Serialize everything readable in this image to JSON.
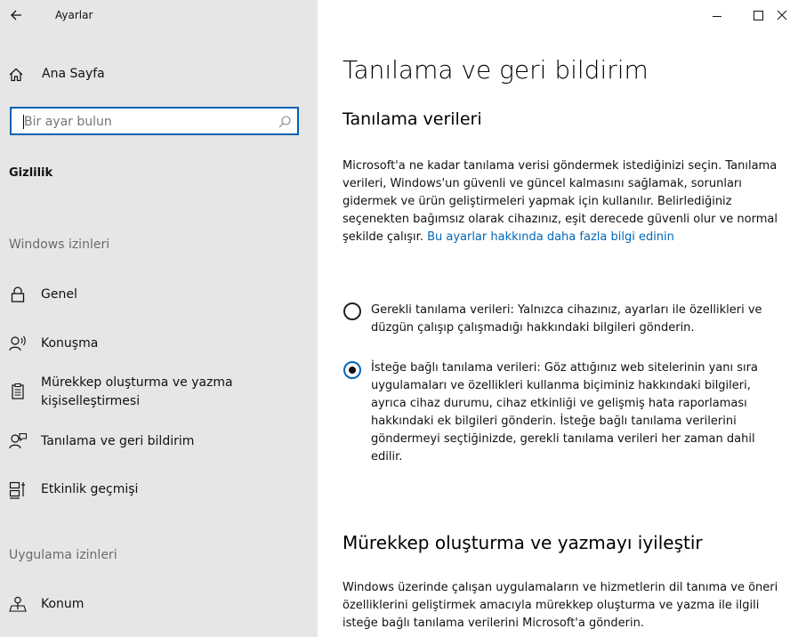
{
  "window": {
    "app_title": "Ayarlar",
    "controls": [
      "minimize-icon",
      "maximize-icon",
      "close-icon"
    ]
  },
  "sidebar": {
    "home_label": "Ana Sayfa",
    "search_placeholder": "Bir ayar bulun",
    "group_title": "Gizlilik",
    "sections": [
      {
        "label": "Windows izinleri",
        "items": [
          {
            "label": "Genel",
            "icon": "lock-icon"
          },
          {
            "label": "Konuşma",
            "icon": "speech-icon"
          },
          {
            "label": "Mürekkep oluşturma ve yazma kişiselleştirmesi",
            "icon": "clipboard-icon"
          },
          {
            "label": "Tanılama ve geri bildirim",
            "icon": "feedback-icon"
          },
          {
            "label": "Etkinlik geçmişi",
            "icon": "activity-history-icon"
          }
        ]
      },
      {
        "label": "Uygulama izinleri",
        "items": [
          {
            "label": "Konum",
            "icon": "location-icon"
          }
        ]
      }
    ]
  },
  "main": {
    "title": "Tanılama ve geri bildirim",
    "diagnostics": {
      "heading": "Tanılama verileri",
      "description": "Microsoft'a ne kadar tanılama verisi göndermek istediğinizi seçin. Tanılama verileri, Windows'un güvenli ve güncel kalmasını sağlamak, sorunları gidermek ve ürün geliştirmeleri yapmak için kullanılır. Belirlediğiniz seçenekten bağımsız olarak cihazınız, eşit derecede güvenli olur ve normal şekilde çalışır.",
      "link": "Bu ayarlar hakkında daha fazla bilgi edinin",
      "options": [
        {
          "label": "Gerekli tanılama verileri: Yalnızca cihazınız, ayarları ile özellikleri ve düzgün çalışıp çalışmadığı hakkındaki bilgileri gönderin.",
          "selected": false
        },
        {
          "label": "İsteğe bağlı tanılama verileri: Göz attığınız web sitelerinin yanı sıra uygulamaları ve özellikleri kullanma biçiminiz hakkındaki bilgileri, ayrıca cihaz durumu, cihaz etkinliği ve gelişmiş hata raporlaması hakkındaki ek bilgileri gönderin. İsteğe bağlı tanılama verilerini göndermeyi seçtiğinizde, gerekli tanılama verileri her zaman dahil edilir.",
          "selected": true
        }
      ]
    },
    "inking": {
      "heading": "Mürekkep oluşturma ve yazmayı iyileştir",
      "description": "Windows üzerinde çalışan uygulamaların ve hizmetlerin dil tanıma ve öneri özelliklerini geliştirmek amacıyla mürekkep oluşturma ve yazma ile ilgili isteğe bağlı tanılama verilerini Microsoft'a gönderin."
    }
  },
  "colors": {
    "sidebar_bg": "#e6e6e6",
    "accent": "#0067b8",
    "search_border": "#0063b1"
  }
}
